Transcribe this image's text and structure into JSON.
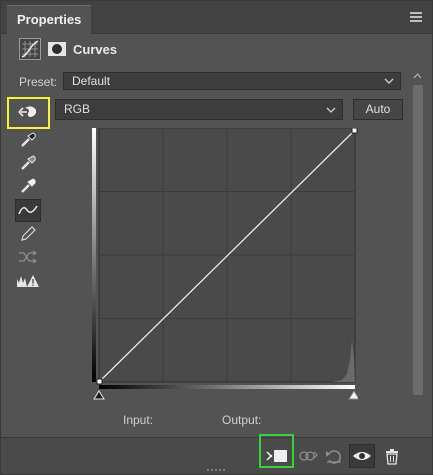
{
  "panel": {
    "tab_label": "Properties",
    "title": "Curves"
  },
  "preset": {
    "label": "Preset:",
    "value": "Default"
  },
  "channel": {
    "value": "RGB"
  },
  "buttons": {
    "auto_label": "Auto"
  },
  "tools": [
    {
      "icon": "targeted-adjustment-icon",
      "selected": false
    },
    {
      "icon": "black-point-eyedropper-icon",
      "selected": false
    },
    {
      "icon": "gray-point-eyedropper-icon",
      "selected": false
    },
    {
      "icon": "white-point-eyedropper-icon",
      "selected": false
    },
    {
      "icon": "curve-point-tool-icon",
      "selected": true
    },
    {
      "icon": "pencil-draw-icon",
      "selected": false
    },
    {
      "icon": "smooth-curve-icon",
      "selected": false
    },
    {
      "icon": "clipping-warning-icon",
      "selected": false
    }
  ],
  "graph": {
    "input_label": "Input:",
    "output_label": "Output:",
    "grid_divisions": 4,
    "curve_points": [
      [
        0,
        0
      ],
      [
        255,
        255
      ]
    ]
  },
  "footer": [
    {
      "icon": "clip-to-layer-icon"
    },
    {
      "icon": "view-previous-state-icon"
    },
    {
      "icon": "reset-adjustment-icon"
    },
    {
      "icon": "toggle-visibility-icon"
    },
    {
      "icon": "delete-layer-icon"
    }
  ],
  "colors": {
    "panel_bg": "#535353",
    "graph_bg": "#4a4a4a",
    "highlight_yellow": "#f5f33a",
    "highlight_green": "#37d13c"
  }
}
